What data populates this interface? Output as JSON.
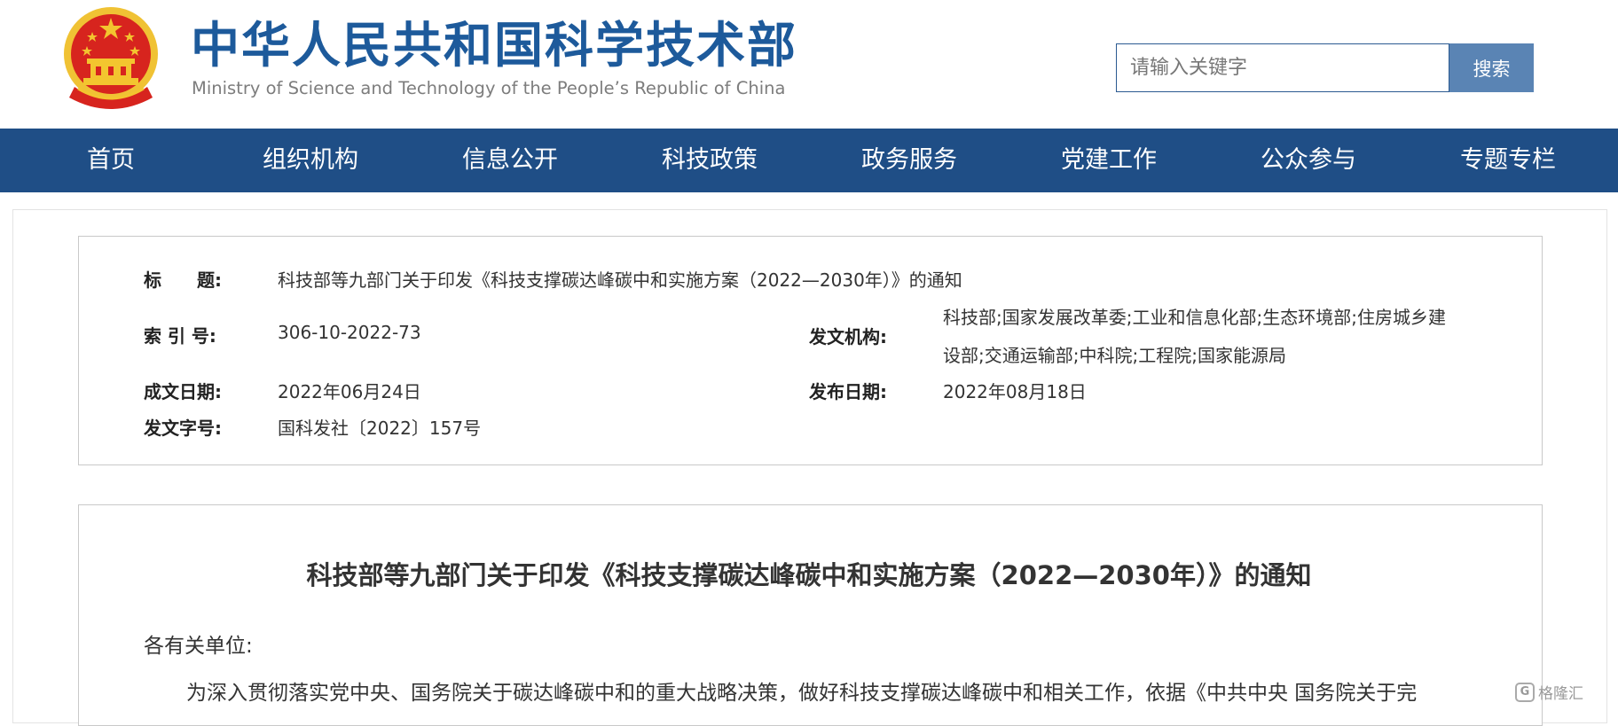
{
  "header": {
    "title_cn": "中华人民共和国科学技术部",
    "title_en": "Ministry of Science and Technology of the People’s Republic of China",
    "search_placeholder": "请输入关键字",
    "search_button": "搜索"
  },
  "nav": {
    "items": [
      {
        "label": "首页"
      },
      {
        "label": "组织机构"
      },
      {
        "label": "信息公开"
      },
      {
        "label": "科技政策"
      },
      {
        "label": "政务服务"
      },
      {
        "label": "党建工作"
      },
      {
        "label": "公众参与"
      },
      {
        "label": "专题专栏"
      }
    ]
  },
  "meta": {
    "title_label": "标　　题:",
    "title_value": "科技部等九部门关于印发《科技支撑碳达峰碳中和实施方案（2022—2030年）》的通知",
    "index_label": "索 引 号:",
    "index_value": "306-10-2022-73",
    "issuer_label": "发文机构:",
    "issuer_value_line1": "科技部;国家发展改革委;工业和信息化部;生态环境部;住房城乡建",
    "issuer_value_line2": "设部;交通运输部;中科院;工程院;国家能源局",
    "created_label": "成文日期:",
    "created_value": "2022年06月24日",
    "published_label": "发布日期:",
    "published_value": "2022年08月18日",
    "doc_no_label": "发文字号:",
    "doc_no_value": "国科发社〔2022〕157号"
  },
  "document": {
    "title": "科技部等九部门关于印发《科技支撑碳达峰碳中和实施方案（2022—2030年）》的通知",
    "salutation": "各有关单位:",
    "paragraph_1": "为深入贯彻落实党中央、国务院关于碳达峰碳中和的重大战略决策，做好科技支撑碳达峰碳中和相关工作，依据《中共中央 国务院关于完"
  },
  "watermark": {
    "text": "格隆汇"
  },
  "colors": {
    "brand_blue": "#1d5a9b",
    "nav_bg": "#1f4e86",
    "search_button_bg": "#5a84b4",
    "emblem_red": "#d7241e",
    "emblem_gold": "#f3c52f"
  }
}
